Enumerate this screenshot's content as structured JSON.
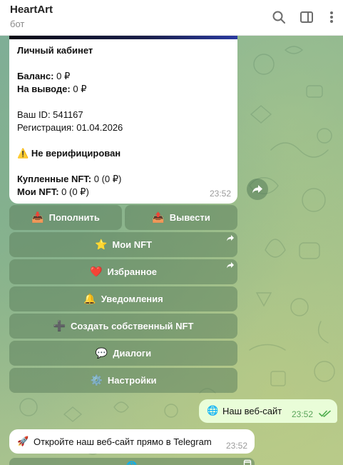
{
  "header": {
    "title": "HeartArt",
    "subtitle": "бот",
    "icons": [
      "search-icon",
      "sidebar-panel-icon",
      "more-vertical-icon"
    ]
  },
  "profile_message": {
    "heading": "Личный кабинет",
    "balance_label": "Баланс:",
    "balance_value": " 0 ₽",
    "withdraw_label": "На выводе:",
    "withdraw_value": " 0 ₽",
    "user_id": "Ваш ID: 541167",
    "registration": "Регистрация: 01.04.2026",
    "verify_emoji": "⚠️",
    "verify_status": "Не верифицирован",
    "bought_label": "Купленные NFT:",
    "bought_value": " 0 (0 ₽)",
    "my_nft_label": "Мои NFT:",
    "my_nft_value": " 0 (0 ₽)",
    "time": "23:52"
  },
  "keyboard": {
    "topup": {
      "emoji": "📥",
      "label": "Пополнить"
    },
    "withdraw": {
      "emoji": "📤",
      "label": "Вывести"
    },
    "my_nft": {
      "emoji": "⭐",
      "label": "Мои NFT"
    },
    "favorites": {
      "emoji": "❤️",
      "label": "Избранное"
    },
    "notifications": {
      "emoji": "🔔",
      "label": "Уведомления"
    },
    "create_nft": {
      "emoji": "➕",
      "label": "Создать собственный NFT"
    },
    "dialogs": {
      "emoji": "💬",
      "label": "Диалоги"
    },
    "settings": {
      "emoji": "⚙️",
      "label": "Настройки"
    }
  },
  "outgoing_message": {
    "emoji": "🌐",
    "text": "Наш веб-сайт",
    "time": "23:52",
    "status": "read"
  },
  "incoming_message_2": {
    "emoji": "🚀",
    "text": "Откройте наш веб-сайт прямо в Telegram",
    "time": "23:52"
  },
  "partial_button": {
    "emoji": "🌐"
  },
  "colors": {
    "outgoing_bubble": "#e9fdd8",
    "read_checks": "#4fae4e",
    "keyboard_button": "rgba(95,130,95,0.55)"
  }
}
